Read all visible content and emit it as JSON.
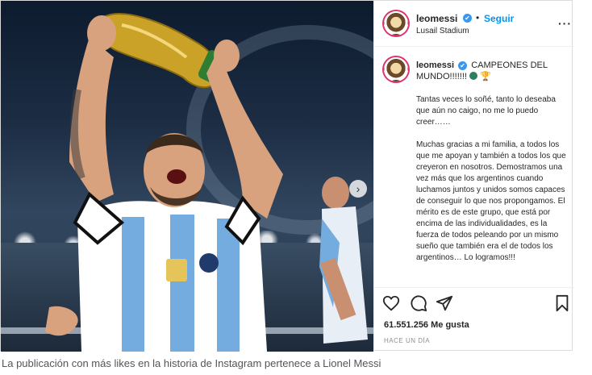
{
  "post": {
    "photo": {
      "next_arrow": "›"
    },
    "header": {
      "username": "leomessi",
      "verified_mark": "✔",
      "separator": "•",
      "follow_label": "Seguir",
      "location": "Lusail Stadium",
      "more_label": "···"
    },
    "caption": {
      "username": "leomessi",
      "verified_mark": "✔",
      "headline": "CAMPEONES DEL MUNDO!!!!!!!",
      "emoji_trophy": "🏆",
      "paragraph_1": "Tantas veces lo soñé, tanto lo deseaba que aún no caigo, no me lo puedo creer……",
      "paragraph_2": "Muchas gracias a mi familia, a todos los que me apoyan y también a todos los que creyeron en nosotros. Demostramos una vez más que los argentinos cuando luchamos juntos y unidos somos capaces de conseguir lo que nos propongamos. El mérito es de este grupo, que está por encima de las individualidades, es la fuerza de todos peleando por un mismo sueño que también era el de todos los argentinos… Lo logramos!!!"
    },
    "actions": {
      "icons": [
        "heart-icon",
        "comment-icon",
        "share-icon",
        "bookmark-icon"
      ],
      "likes": "61.551.256 Me gusta",
      "timestamp": "HACE UN DÍA"
    }
  },
  "article_caption": "La publicación con más likes en la historia de Instagram pertenece a Lionel Messi",
  "colors": {
    "follow": "#0095f6",
    "verified": "#3897f0",
    "border": "#dbdbdb"
  }
}
